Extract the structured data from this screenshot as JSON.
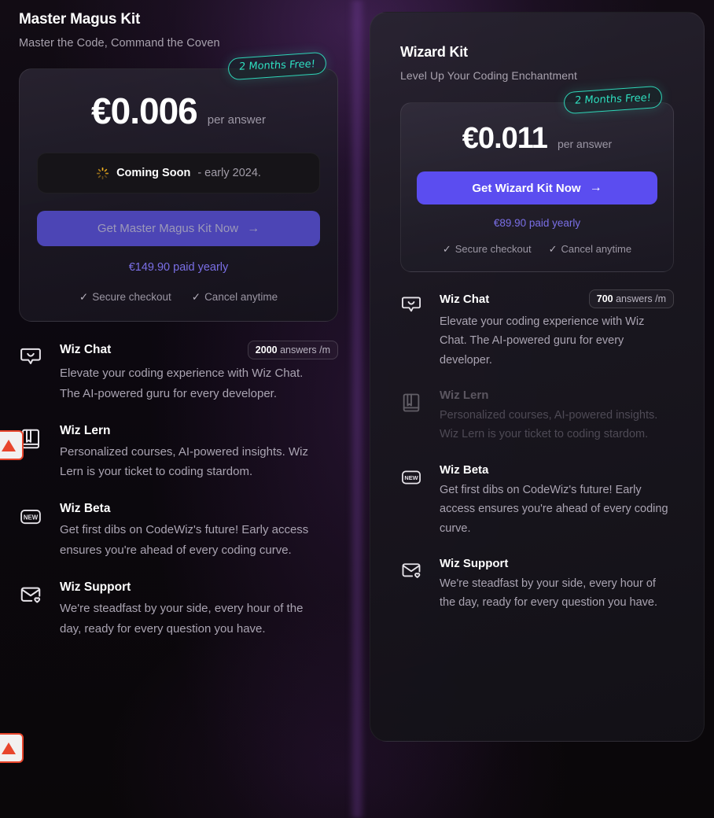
{
  "theme": {
    "accent_purple": "#5b4df0",
    "accent_teal": "#2fe0c0",
    "marker_red": "#e8452c",
    "background": "#0a0709",
    "card_surface": "#26222e"
  },
  "left_panel": {
    "title": "Master Magus Kit",
    "subtitle": "Master the Code, Command the Coven",
    "badge": "2 Months Free!",
    "price": {
      "amount": "€0.006",
      "unit": "per answer"
    },
    "status": {
      "icon": "spinner-icon",
      "label": "Coming Soon",
      "detail": "- early 2024."
    },
    "cta": {
      "label": "Get Master Magus Kit Now",
      "arrow": "→",
      "disabled": true
    },
    "billing_note": "€149.90 paid yearly",
    "assurances": [
      {
        "check": "✓",
        "label": "Secure checkout"
      },
      {
        "check": "✓",
        "label": "Cancel anytime"
      }
    ],
    "features": [
      {
        "icon": "chat-bubble-smile-icon",
        "name": "Wiz Chat",
        "pill_value": "2000",
        "pill_unit": "answers /m",
        "description": "Elevate your coding experience with Wiz Chat. The AI-powered guru for every developer.",
        "dimmed": false
      },
      {
        "icon": "book-icon",
        "name": "Wiz Lern",
        "pill_value": "",
        "pill_unit": "",
        "description": "Personalized courses, AI-powered insights. Wiz Lern is your ticket to coding stardom.",
        "dimmed": false
      },
      {
        "icon": "new-badge-icon",
        "name": "Wiz Beta",
        "pill_value": "",
        "pill_unit": "",
        "description": "Get first dibs on CodeWiz's future! Early access ensures you're ahead of every coding curve.",
        "dimmed": false
      },
      {
        "icon": "mail-heart-icon",
        "name": "Wiz Support",
        "pill_value": "",
        "pill_unit": "",
        "description": "We're steadfast by your side, every hour of the day, ready for every question you have.",
        "dimmed": false
      }
    ]
  },
  "right_panel": {
    "title": "Wizard Kit",
    "subtitle": "Level Up Your Coding Enchantment",
    "badge": "2 Months Free!",
    "price": {
      "amount": "€0.011",
      "unit": "per answer"
    },
    "cta": {
      "label": "Get Wizard Kit Now",
      "arrow": "→",
      "disabled": false
    },
    "billing_note": "€89.90 paid yearly",
    "assurances": [
      {
        "check": "✓",
        "label": "Secure checkout"
      },
      {
        "check": "✓",
        "label": "Cancel anytime"
      }
    ],
    "features": [
      {
        "icon": "chat-bubble-smile-icon",
        "name": "Wiz Chat",
        "pill_value": "700",
        "pill_unit": "answers /m",
        "description": "Elevate your coding experience with Wiz Chat. The AI-powered guru for every developer.",
        "dimmed": false
      },
      {
        "icon": "book-icon",
        "name": "Wiz Lern",
        "pill_value": "",
        "pill_unit": "",
        "description": "Personalized courses, AI-powered insights. Wiz Lern is your ticket to coding stardom.",
        "dimmed": true
      },
      {
        "icon": "new-badge-icon",
        "name": "Wiz Beta",
        "pill_value": "",
        "pill_unit": "",
        "description": "Get first dibs on CodeWiz's future! Early access ensures you're ahead of every coding curve.",
        "dimmed": false
      },
      {
        "icon": "mail-heart-icon",
        "name": "Wiz Support",
        "pill_value": "",
        "pill_unit": "",
        "description": "We're steadfast by your side, every hour of the day, ready for every question you have.",
        "dimmed": false
      }
    ]
  },
  "annotations": {
    "markers": [
      {
        "icon": "warning-triangle-icon"
      },
      {
        "icon": "warning-triangle-icon"
      }
    ]
  }
}
